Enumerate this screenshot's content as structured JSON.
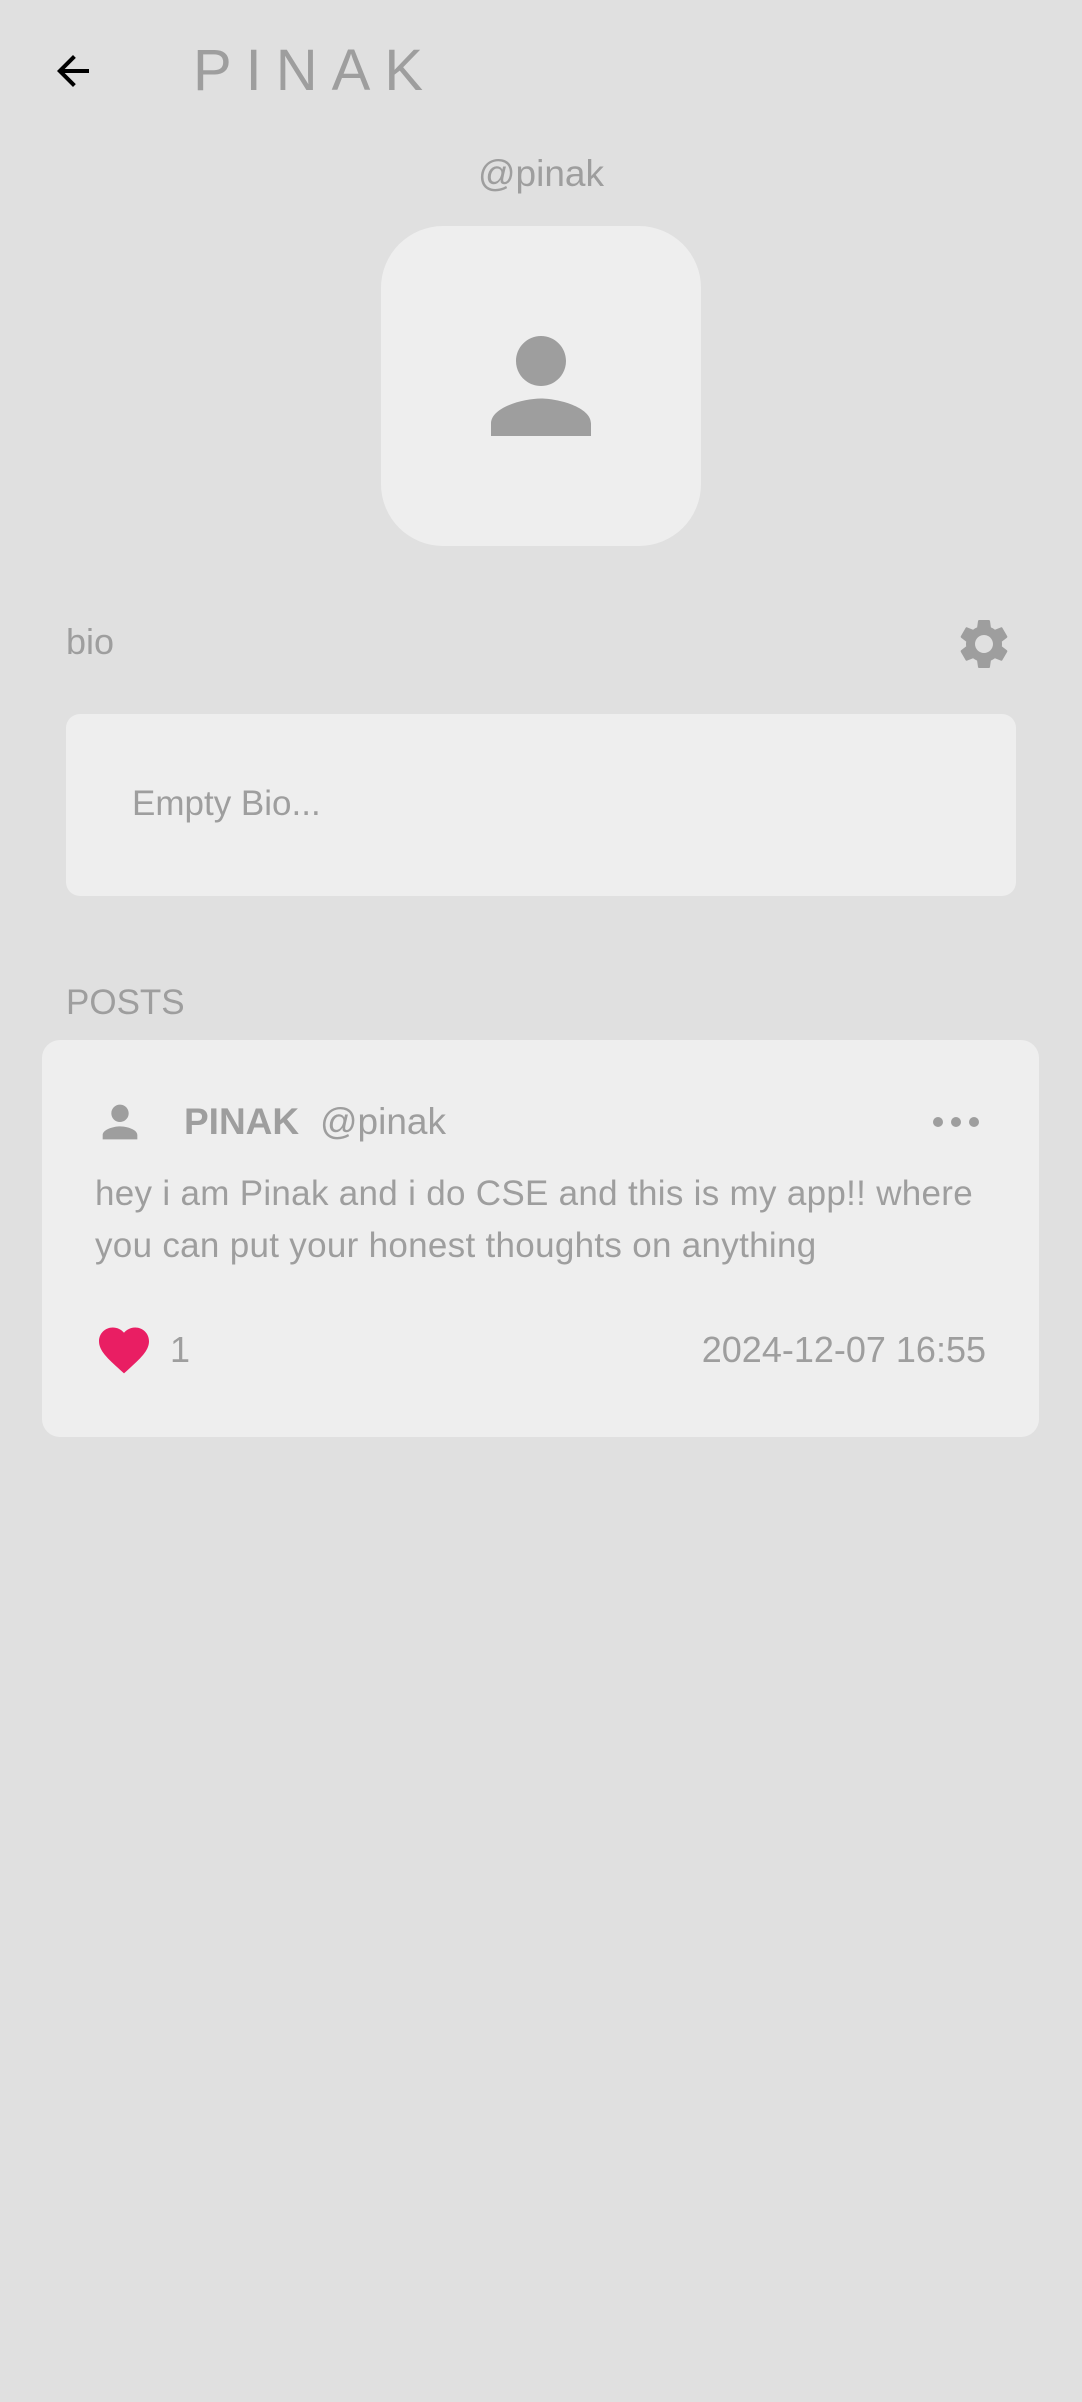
{
  "app_bar": {
    "title": "PINAK",
    "back_icon": "arrow-back-icon"
  },
  "profile": {
    "username": "@pinak",
    "avatar_icon": "person-icon"
  },
  "bio": {
    "label": "bio",
    "settings_icon": "gear-icon",
    "text": "Empty Bio..."
  },
  "posts": {
    "header": "POSTS",
    "items": [
      {
        "name": "PINAK",
        "handle": "@pinak",
        "body": "hey i am Pinak and i do CSE and this is my app!! where you can put your honest thoughts on anything",
        "likes": "1",
        "date": "2024-12-07 16:55",
        "more_icon": "more-horizontal-icon",
        "like_icon": "heart-icon"
      }
    ]
  },
  "colors": {
    "background": "#e0e0e0",
    "surface": "#eeeeee",
    "text": "#9e9e9e",
    "like": "#e91e63"
  }
}
